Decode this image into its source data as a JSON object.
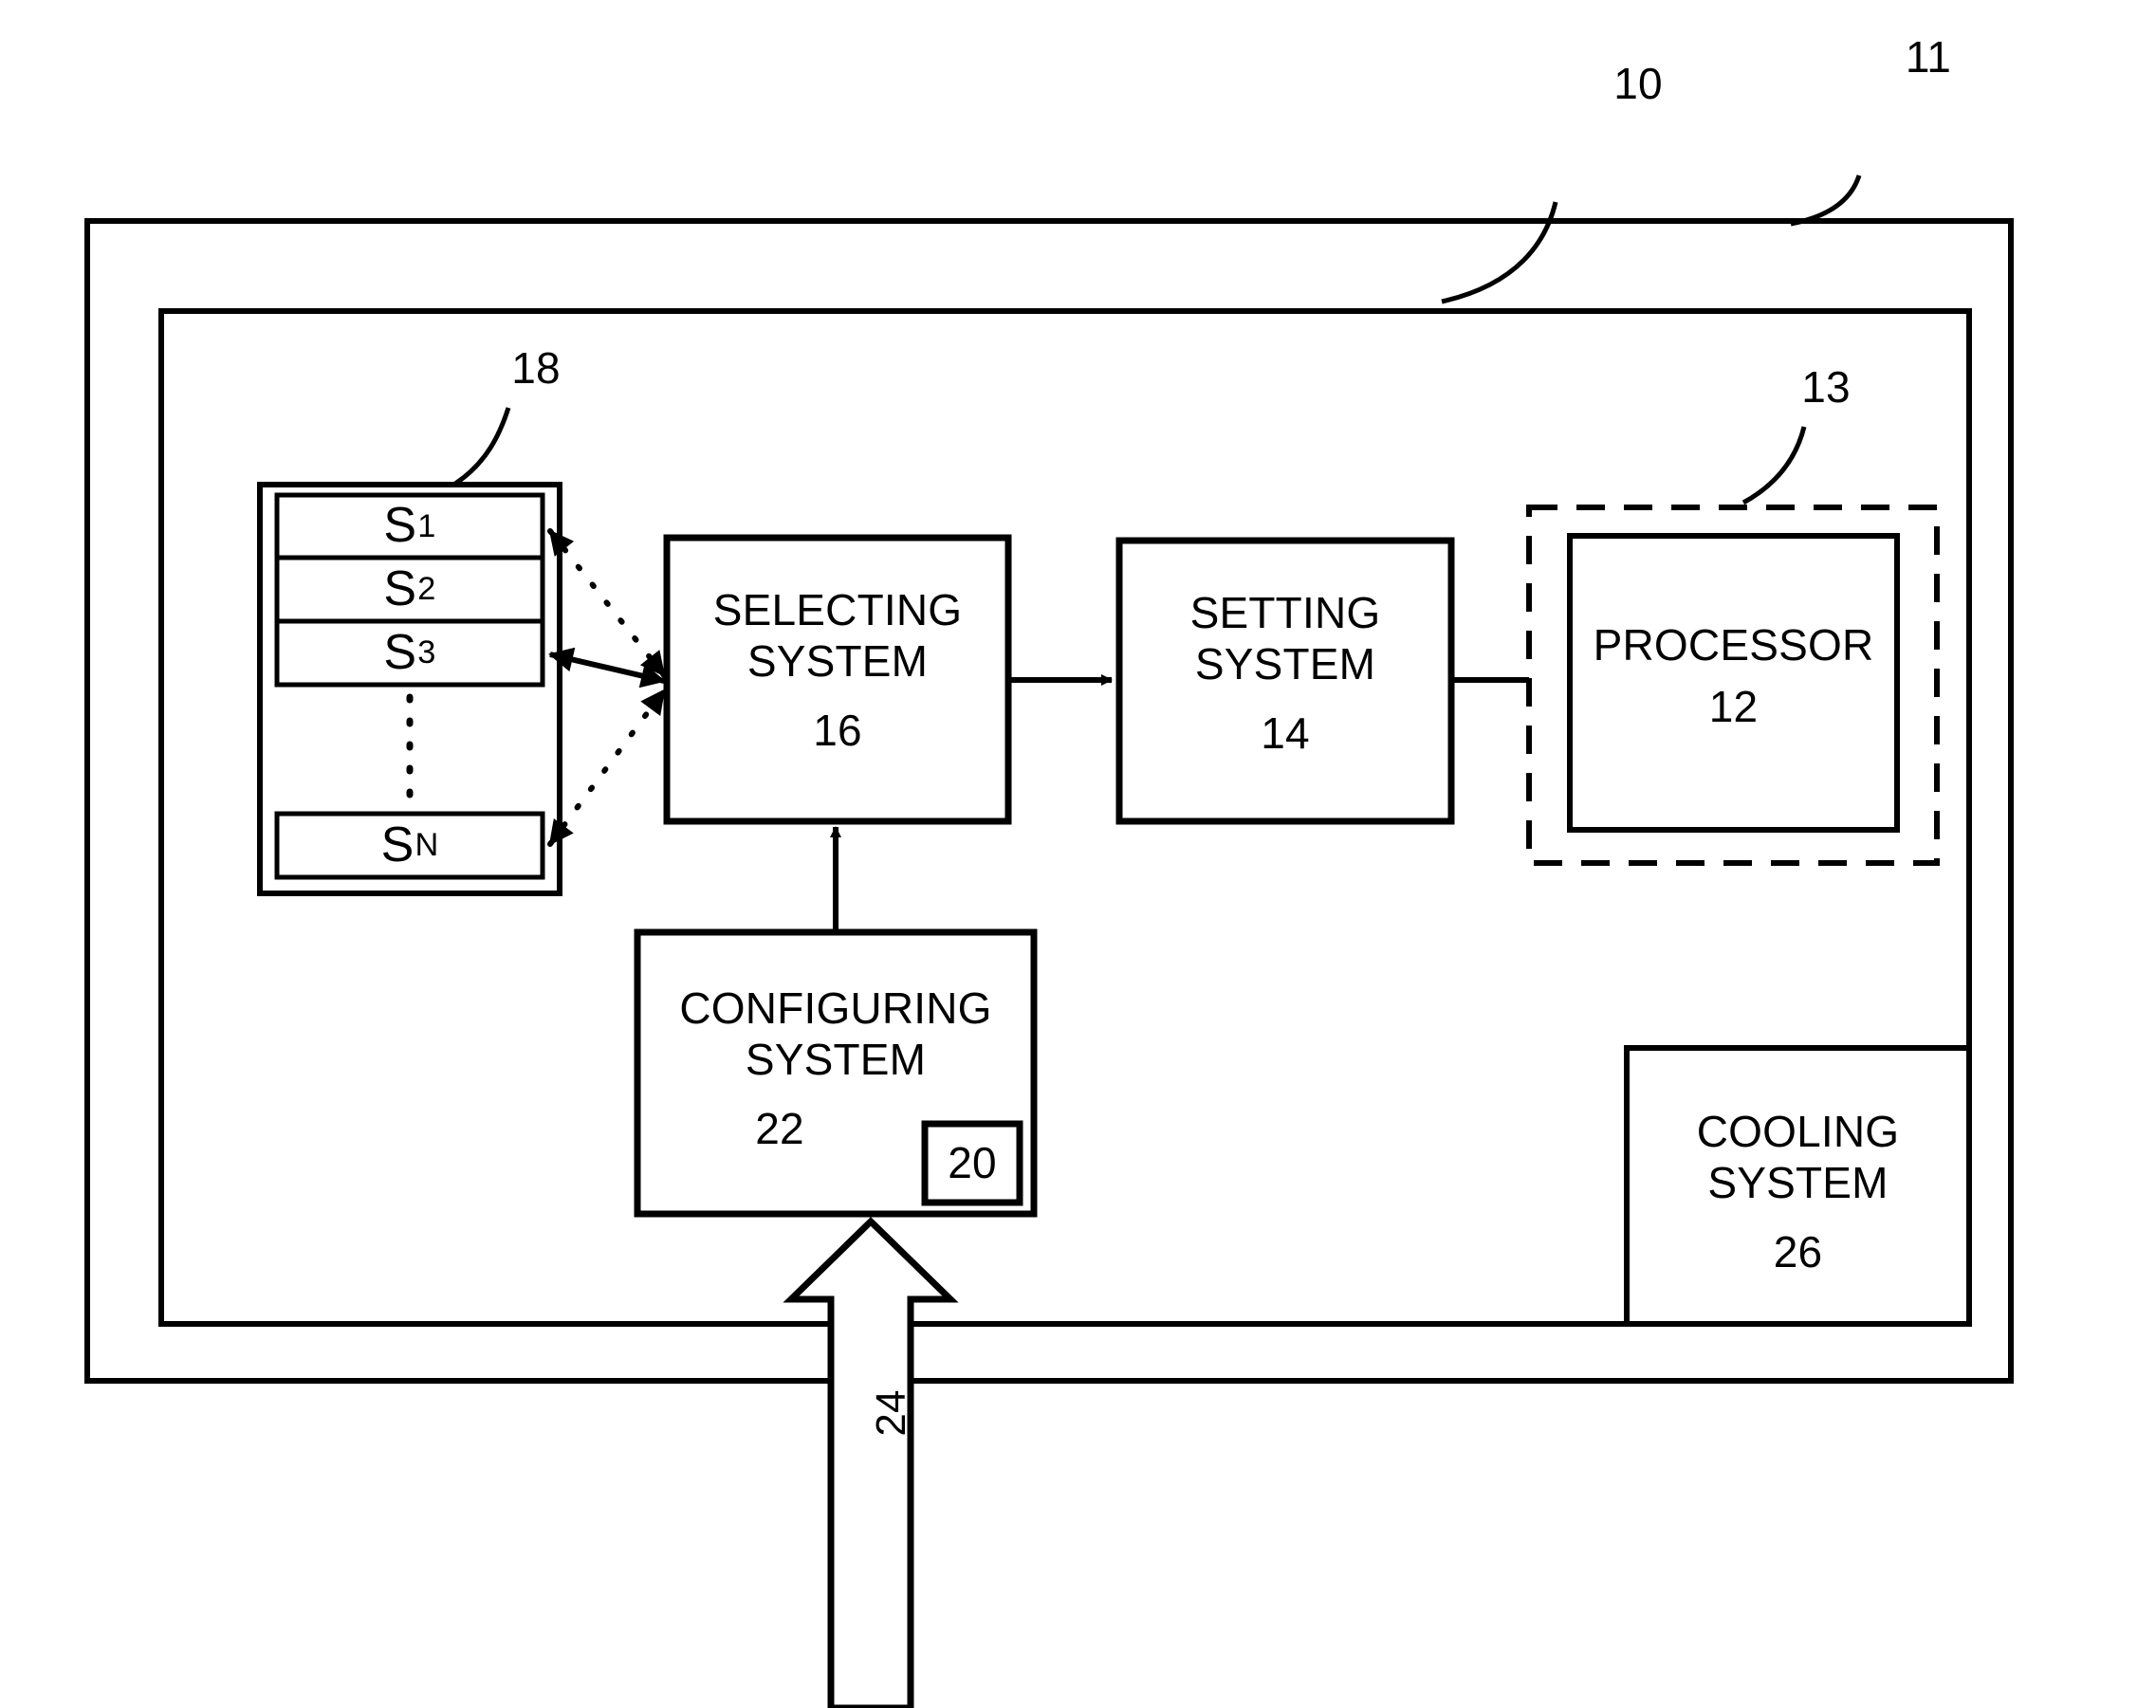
{
  "figure": {
    "type": "patent-block-diagram",
    "background_color": "#ffffff",
    "line_color": "#000000"
  },
  "reference_numerals": {
    "outer_enclosure": "11",
    "inner_enclosure": "10",
    "processor_module": "13",
    "state_store": "18",
    "input_arrow": "24"
  },
  "blocks": {
    "selecting_system": {
      "title": "SELECTING\nSYSTEM",
      "number": "16"
    },
    "setting_system": {
      "title": "SETTING\nSYSTEM",
      "number": "14"
    },
    "processor": {
      "title": "PROCESSOR",
      "number": "12"
    },
    "configuring_system": {
      "title": "CONFIGURING\nSYSTEM",
      "number": "22"
    },
    "configuring_badge": {
      "number": "20"
    },
    "cooling_system": {
      "title": "COOLING\nSYSTEM",
      "number": "26"
    }
  },
  "state_store": {
    "label": "18",
    "states": [
      {
        "base": "S",
        "index": "1"
      },
      {
        "base": "S",
        "index": "2"
      },
      {
        "base": "S",
        "index": "3"
      },
      {
        "base": "S",
        "index": "N"
      }
    ],
    "ellipsis": "vertical-dots"
  },
  "connectors": [
    {
      "name": "state-1-to-selecting",
      "style": "dotted",
      "heads": "both"
    },
    {
      "name": "state-3-to-selecting",
      "style": "solid",
      "heads": "both"
    },
    {
      "name": "state-n-to-selecting",
      "style": "dotted",
      "heads": "both"
    },
    {
      "name": "selecting-to-setting",
      "style": "solid",
      "heads": "end"
    },
    {
      "name": "setting-to-processor",
      "style": "solid",
      "heads": "none"
    },
    {
      "name": "configuring-to-selecting",
      "style": "solid",
      "heads": "end"
    },
    {
      "name": "external-input-to-configuring",
      "style": "block-arrow",
      "heads": "end"
    }
  ]
}
